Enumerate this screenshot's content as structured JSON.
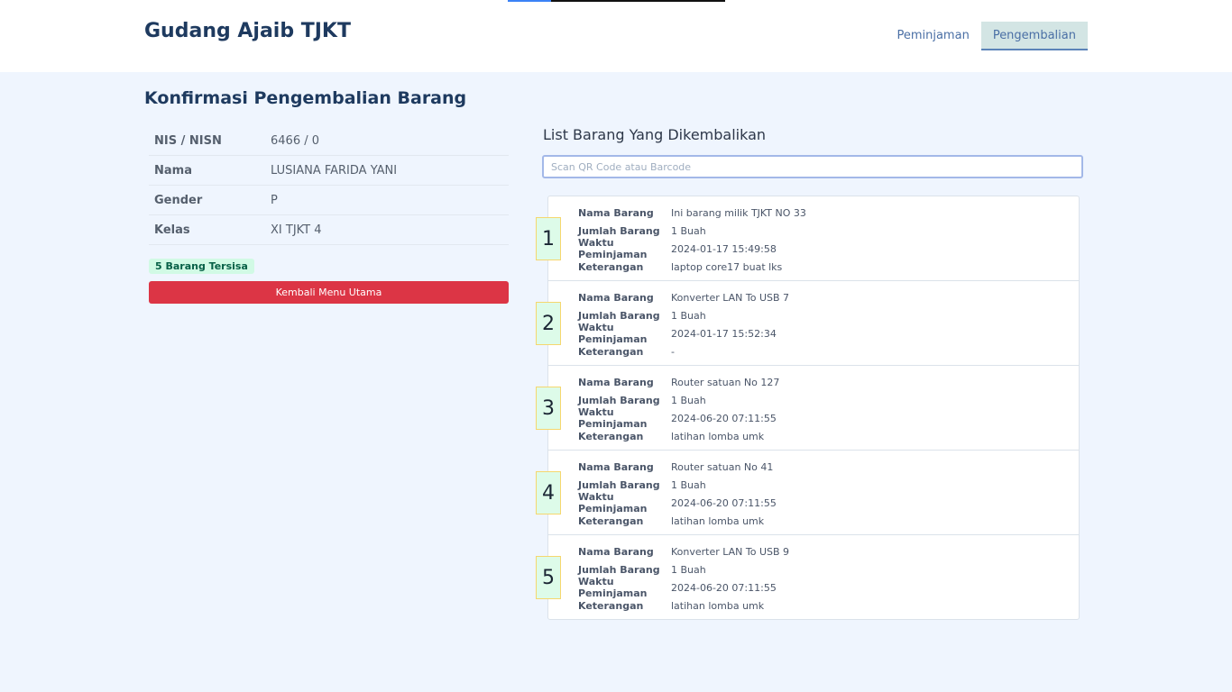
{
  "header": {
    "brand": "Gudang Ajaib TJKT",
    "nav": [
      "Peminjaman",
      "Pengembalian"
    ],
    "active_nav": "Pengembalian",
    "progress": 0.2
  },
  "page_title": "Konfirmasi Pengembalian Barang",
  "student": [
    {
      "key": "NIS / NISN",
      "value": "6466 / 0"
    },
    {
      "key": "Nama",
      "value": "LUSIANA FARIDA YANI"
    },
    {
      "key": "Gender",
      "value": "P"
    },
    {
      "key": "Kelas",
      "value": "XI TJKT 4"
    }
  ],
  "badge": "5 Barang Tersisa",
  "back_button": "Kembali Menu Utama",
  "list_title": "List Barang Yang Dikembalikan",
  "scan": {
    "placeholder": "Scan QR Code atau Barcode",
    "value": ""
  },
  "labels": {
    "name": "Nama Barang",
    "qty": "Jumlah Barang",
    "time": "Waktu Peminjaman",
    "note": "Keterangan"
  },
  "items": [
    {
      "num": "1",
      "name": "Ini barang milik TJKT NO 33",
      "qty": "1 Buah",
      "time": "2024-01-17 15:49:58",
      "note": "laptop core17 buat lks"
    },
    {
      "num": "2",
      "name": "Konverter LAN To USB 7",
      "qty": "1 Buah",
      "time": "2024-01-17 15:52:34",
      "note": "-"
    },
    {
      "num": "3",
      "name": "Router satuan No 127",
      "qty": "1 Buah",
      "time": "2024-06-20 07:11:55",
      "note": "latihan lomba umk"
    },
    {
      "num": "4",
      "name": "Router satuan No 41",
      "qty": "1 Buah",
      "time": "2024-06-20 07:11:55",
      "note": "latihan lomba umk"
    },
    {
      "num": "5",
      "name": "Konverter LAN To USB 9",
      "qty": "1 Buah",
      "time": "2024-06-20 07:11:55",
      "note": "latihan lomba umk"
    }
  ]
}
